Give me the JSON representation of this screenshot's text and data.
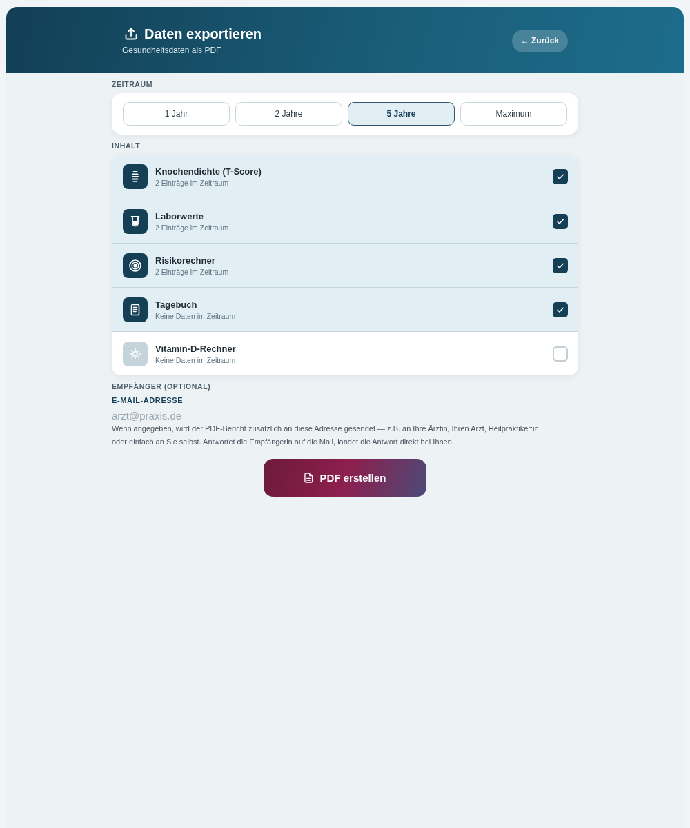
{
  "header": {
    "title": "Daten exportieren",
    "subtitle": "Gesundheitsdaten als PDF",
    "back_button": "← Zurück"
  },
  "period": {
    "label": "ZEITRAUM",
    "options": [
      {
        "label": "1 Jahr",
        "selected": false
      },
      {
        "label": "2 Jahre",
        "selected": false
      },
      {
        "label": "5 Jahre",
        "selected": true
      },
      {
        "label": "Maximum",
        "selected": false
      }
    ]
  },
  "content": {
    "label": "INHALT",
    "items": [
      {
        "kind": "spine",
        "title": "Knochendichte (T-Score)",
        "detail": "2 Einträge im Zeitraum",
        "checked": true
      },
      {
        "kind": "tube",
        "title": "Laborwerte",
        "detail": "2 Einträge im Zeitraum",
        "checked": true
      },
      {
        "kind": "target",
        "title": "Risikorechner",
        "detail": "2 Einträge im Zeitraum",
        "checked": true
      },
      {
        "kind": "notes",
        "title": "Tagebuch",
        "detail": "Keine Daten im Zeitraum",
        "checked": true
      },
      {
        "kind": "sun",
        "title": "Vitamin-D-Rechner",
        "detail": "Keine Daten im Zeitraum",
        "checked": false
      }
    ]
  },
  "recipient": {
    "label": "EMPFÄNGER (OPTIONAL)",
    "field_label": "E-MAIL-ADRESSE",
    "placeholder": "arzt@praxis.de",
    "help": "Wenn angegeben, wird der PDF-Bericht zusätzlich an diese Adresse gesendet — z.B. an Ihre Ärztin, Ihren Arzt, Heilpraktiker:in oder einfach an Sie selbst. Antwortet die Empfängerin auf die Mail, landet die Antwort direkt bei Ihnen."
  },
  "submit_button": "PDF erstellen"
}
